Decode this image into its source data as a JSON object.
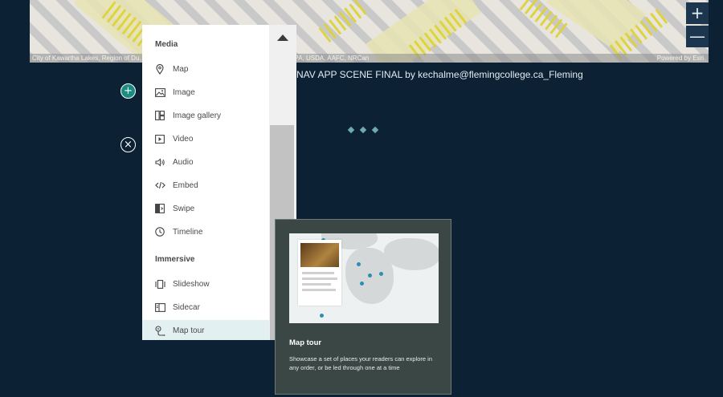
{
  "map": {
    "attribution": "City of Kawartha Lakes, Region of Du… …s, Esri, HERE, Garmin, INCREMENT P, USGS, EPA, USDA, AAFC, NRCan",
    "powered_by": "Powered by Esri",
    "zoom_in": "+",
    "zoom_out": "—"
  },
  "caption": "NAV APP SCENE FINAL by kechalme@flemingcollege.ca_Fleming",
  "controls": {
    "add": "+",
    "close": "×"
  },
  "menu": {
    "sections": [
      {
        "heading": "Media"
      },
      {
        "heading": "Immersive"
      }
    ],
    "items": [
      {
        "label": "Map",
        "icon": "map-pin-icon"
      },
      {
        "label": "Image",
        "icon": "image-icon"
      },
      {
        "label": "Image gallery",
        "icon": "image-gallery-icon"
      },
      {
        "label": "Video",
        "icon": "video-icon"
      },
      {
        "label": "Audio",
        "icon": "audio-icon"
      },
      {
        "label": "Embed",
        "icon": "embed-icon"
      },
      {
        "label": "Swipe",
        "icon": "swipe-icon"
      },
      {
        "label": "Timeline",
        "icon": "timeline-icon"
      },
      {
        "label": "Slideshow",
        "icon": "slideshow-icon"
      },
      {
        "label": "Sidecar",
        "icon": "sidecar-icon"
      },
      {
        "label": "Map tour",
        "icon": "map-tour-icon",
        "active": true
      }
    ]
  },
  "tooltip": {
    "title": "Map tour",
    "description": "Showcase a set of places your readers can explore in any order, or be led through one at a time"
  },
  "colors": {
    "background": "#0c2234",
    "accent": "#1b8c82",
    "tooltip_bg": "#3a4744"
  }
}
